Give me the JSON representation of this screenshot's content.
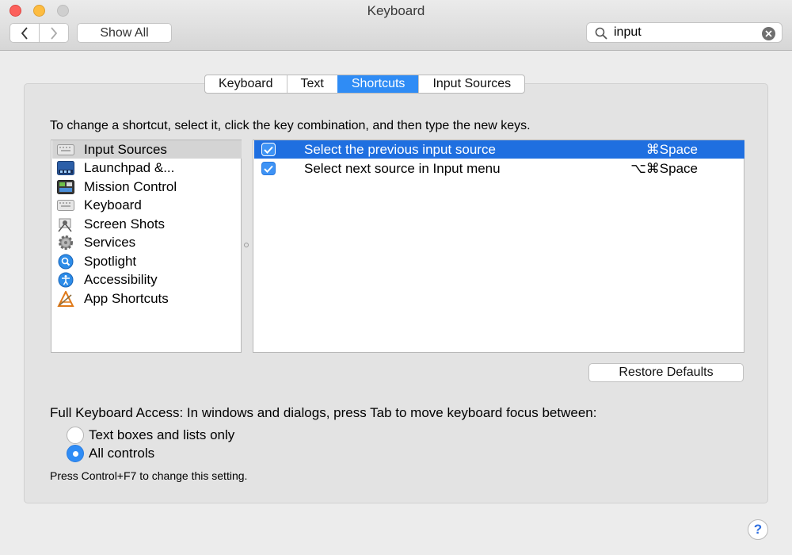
{
  "window": {
    "title": "Keyboard"
  },
  "toolbar": {
    "show_all_label": "Show All"
  },
  "search": {
    "value": "input",
    "placeholder": ""
  },
  "tabs": [
    {
      "label": "Keyboard",
      "active": false
    },
    {
      "label": "Text",
      "active": false
    },
    {
      "label": "Shortcuts",
      "active": true
    },
    {
      "label": "Input Sources",
      "active": false
    }
  ],
  "instructions": "To change a shortcut, select it, click the key combination, and then type the new keys.",
  "categories": [
    {
      "label": "Input Sources",
      "icon": "keyboard-icon",
      "selected": true
    },
    {
      "label": "Launchpad &...",
      "icon": "launchpad-icon",
      "selected": false
    },
    {
      "label": "Mission Control",
      "icon": "mission-control-icon",
      "selected": false
    },
    {
      "label": "Keyboard",
      "icon": "keyboard-icon",
      "selected": false
    },
    {
      "label": "Screen Shots",
      "icon": "screenshot-icon",
      "selected": false
    },
    {
      "label": "Services",
      "icon": "gear-icon",
      "selected": false
    },
    {
      "label": "Spotlight",
      "icon": "spotlight-icon",
      "selected": false
    },
    {
      "label": "Accessibility",
      "icon": "accessibility-icon",
      "selected": false
    },
    {
      "label": "App Shortcuts",
      "icon": "app-shortcuts-icon",
      "selected": false
    }
  ],
  "shortcuts": [
    {
      "label": "Select the previous input source",
      "key": "⌘Space",
      "checked": true,
      "selected": true
    },
    {
      "label": "Select next source in Input menu",
      "key": "⌥⌘Space",
      "checked": true,
      "selected": false
    }
  ],
  "restore_label": "Restore Defaults",
  "full_keyboard_access": {
    "label": "Full Keyboard Access: In windows and dialogs, press Tab to move keyboard focus between:",
    "options": [
      {
        "label": "Text boxes and lists only",
        "selected": false
      },
      {
        "label": "All controls",
        "selected": true
      }
    ],
    "note": "Press Control+F7 to change this setting."
  },
  "help_label": "?",
  "colors": {
    "accent": "#2f8cf5",
    "selection": "#1f6fe0"
  }
}
